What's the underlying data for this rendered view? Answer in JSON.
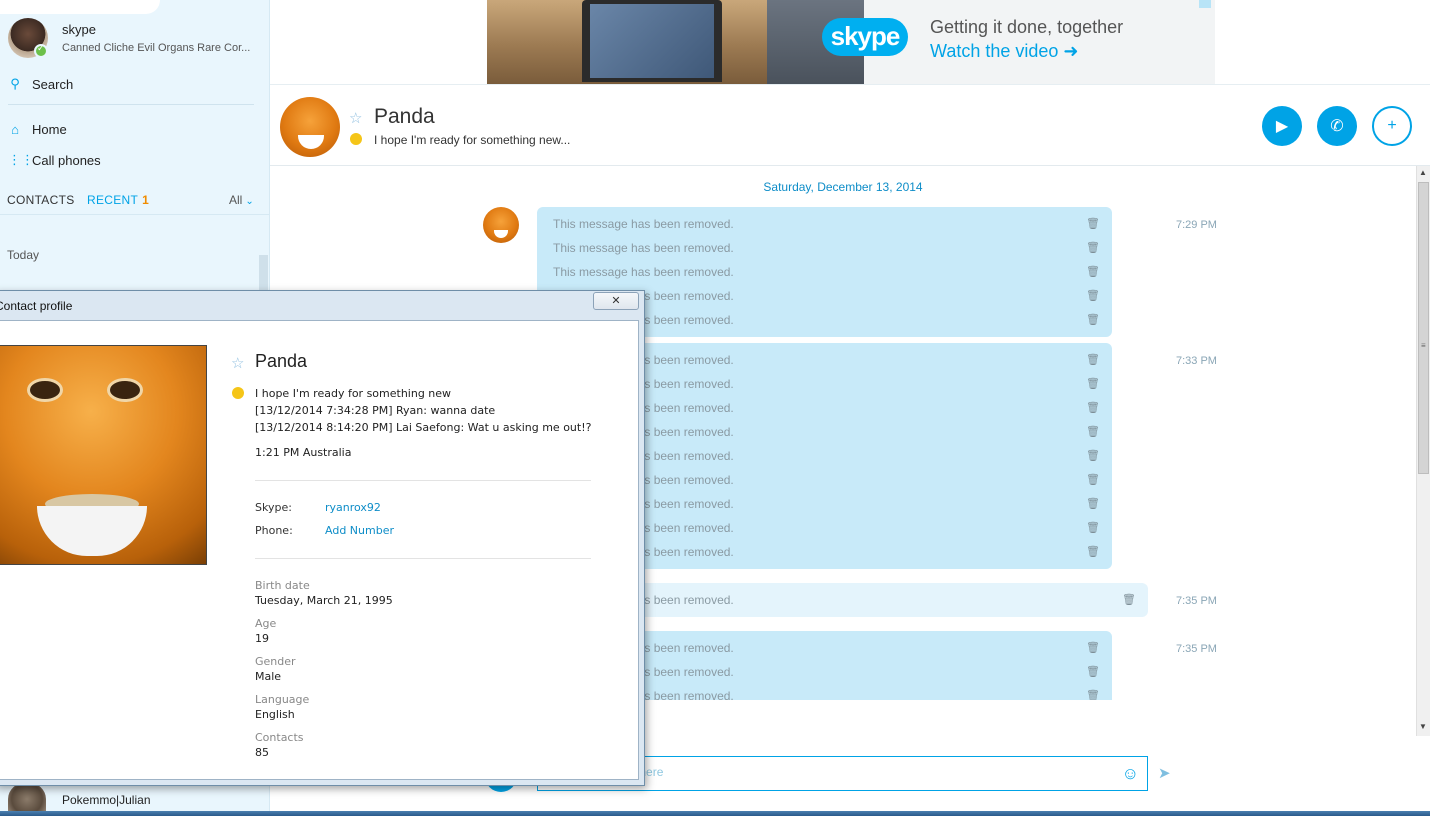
{
  "sidebar": {
    "user_name": "skype",
    "user_mood": "Canned Cliche Evil Organs Rare Cor...",
    "search_label": "Search",
    "home_label": "Home",
    "call_phones_label": "Call phones",
    "tab_contacts": "CONTACTS",
    "tab_recent": "RECENT",
    "recent_count": "1",
    "filter_label": "All",
    "section_today": "Today",
    "bottom_contact_name": "Pokemmo|Julian"
  },
  "ad": {
    "logo_text": "skype",
    "tagline": "Getting it done, together",
    "cta": "Watch the video ➜"
  },
  "chat_header": {
    "peer_name": "Panda",
    "peer_mood": "I hope I'm ready for something new..."
  },
  "conversation": {
    "date": "Saturday, December 13, 2014",
    "groups": [
      {
        "time": "7:29 PM",
        "messages": [
          "This message has been removed.",
          "This message has been removed.",
          "This message has been removed.",
          "This message has been removed.",
          "This message has been removed."
        ]
      },
      {
        "time": "7:33 PM",
        "messages": [
          "This message has been removed.",
          "This message has been removed.",
          "This message has been removed.",
          "This message has been removed.",
          "This message has been removed.",
          "This message has been removed.",
          "This message has been removed.",
          "This message has been removed.",
          "This message has been removed."
        ]
      },
      {
        "time": "7:35 PM",
        "messages": [
          "This message has been removed."
        ]
      },
      {
        "time": "7:35 PM",
        "messages": [
          "This message has been removed.",
          "This message has been removed.",
          "This message has been removed."
        ]
      }
    ]
  },
  "compose": {
    "placeholder": "Type a message here"
  },
  "profile": {
    "window_title": "Contact profile",
    "close_glyph": "✕",
    "name": "Panda",
    "mood": "I hope I'm ready for something new",
    "history_1": "[13/12/2014 7:34:28 PM] Ryan: wanna date",
    "history_2": "[13/12/2014 8:14:20 PM] Lai Saefong: Wat u asking me out!?",
    "local_time": "1:21 PM Australia",
    "skype_key": "Skype:",
    "skype_value": "ryanrox92",
    "phone_key": "Phone:",
    "phone_value": "Add Number",
    "birth_label": "Birth date",
    "birth_value": "Tuesday, March 21, 1995",
    "age_label": "Age",
    "age_value": "19",
    "gender_label": "Gender",
    "gender_value": "Male",
    "language_label": "Language",
    "language_value": "English",
    "contacts_label": "Contacts",
    "contacts_value": "85"
  }
}
